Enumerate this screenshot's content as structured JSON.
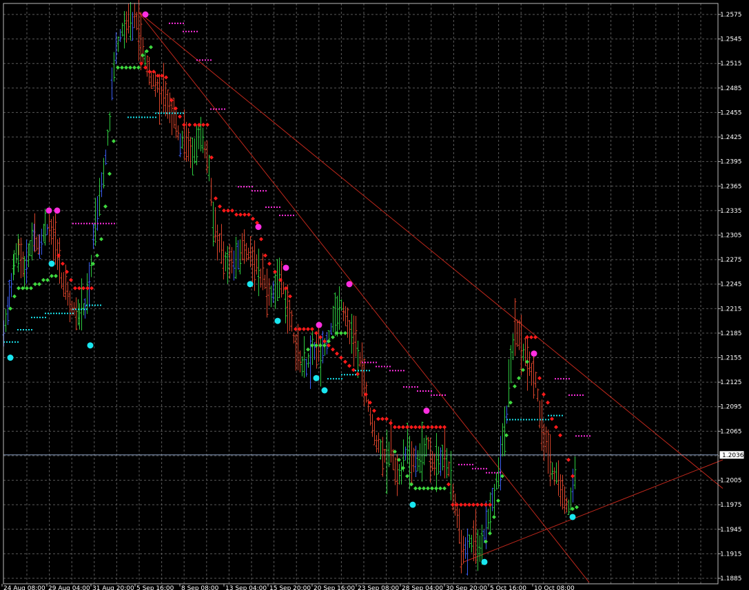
{
  "chart_data": {
    "type": "candlestick",
    "y_ticks": [
      "1.2575",
      "1.2545",
      "1.2515",
      "1.2485",
      "1.2455",
      "1.2425",
      "1.2395",
      "1.2365",
      "1.2335",
      "1.2305",
      "1.2275",
      "1.2245",
      "1.2215",
      "1.2185",
      "1.2155",
      "1.2125",
      "1.2095",
      "1.2065",
      "1.2035",
      "1.2005",
      "1.1975",
      "1.1945",
      "1.1915",
      "1.1885"
    ],
    "x_ticks": [
      "24 Aug 08:00",
      "29 Aug 04:00",
      "31 Aug 20:00",
      "5 Sep 16:00",
      "8 Sep 08:00",
      "13 Sep 04:00",
      "15 Sep 20:00",
      "20 Sep 16:00",
      "23 Sep 08:00",
      "28 Sep 04:00",
      "30 Sep 20:00",
      "5 Oct 16:00",
      "10 Oct 08:00"
    ],
    "ylim": [
      1.1885,
      1.26
    ],
    "current_price": "1.2036",
    "grid": true,
    "background": "#000000",
    "grid_color": "#5a5a5a",
    "colors": {
      "bull": "#2ecc40",
      "bear": "#d9442b",
      "blue": "#3a5cf0",
      "red_dots": "#ff1a1a",
      "green_dots": "#3fd83f",
      "cyan_dots": "#19e6f0",
      "magenta_dots": "#ff2ee0",
      "trendline": "#c0281c",
      "price_line": "#8fa6c8"
    },
    "price_path": [
      [
        0,
        1.218
      ],
      [
        8,
        1.223
      ],
      [
        15,
        1.227
      ],
      [
        22,
        1.229
      ],
      [
        30,
        1.226
      ],
      [
        38,
        1.229
      ],
      [
        45,
        1.23
      ],
      [
        52,
        1.2295
      ],
      [
        60,
        1.231
      ],
      [
        66,
        1.2315
      ],
      [
        72,
        1.23
      ],
      [
        78,
        1.229
      ],
      [
        84,
        1.225
      ],
      [
        90,
        1.224
      ],
      [
        96,
        1.222
      ],
      [
        102,
        1.2215
      ],
      [
        110,
        1.221
      ],
      [
        118,
        1.2215
      ],
      [
        124,
        1.224
      ],
      [
        130,
        1.23
      ],
      [
        136,
        1.233
      ],
      [
        142,
        1.237
      ],
      [
        148,
        1.24
      ],
      [
        154,
        1.245
      ],
      [
        160,
        1.251
      ],
      [
        166,
        1.254
      ],
      [
        172,
        1.2555
      ],
      [
        178,
        1.2565
      ],
      [
        184,
        1.256
      ],
      [
        190,
        1.257
      ],
      [
        196,
        1.256
      ],
      [
        202,
        1.253
      ],
      [
        208,
        1.251
      ],
      [
        214,
        1.25
      ],
      [
        220,
        1.249
      ],
      [
        226,
        1.248
      ],
      [
        232,
        1.2475
      ],
      [
        238,
        1.247
      ],
      [
        244,
        1.2455
      ],
      [
        250,
        1.244
      ],
      [
        256,
        1.242
      ],
      [
        262,
        1.242
      ],
      [
        268,
        1.241
      ],
      [
        274,
        1.24
      ],
      [
        280,
        1.242
      ],
      [
        286,
        1.243
      ],
      [
        292,
        1.241
      ],
      [
        298,
        1.239
      ],
      [
        304,
        1.233
      ],
      [
        310,
        1.23
      ],
      [
        316,
        1.2285
      ],
      [
        322,
        1.2275
      ],
      [
        328,
        1.228
      ],
      [
        334,
        1.227
      ],
      [
        340,
        1.228
      ],
      [
        346,
        1.229
      ],
      [
        352,
        1.2285
      ],
      [
        358,
        1.228
      ],
      [
        364,
        1.227
      ],
      [
        370,
        1.226
      ],
      [
        376,
        1.225
      ],
      [
        382,
        1.224
      ],
      [
        388,
        1.223
      ],
      [
        394,
        1.2235
      ],
      [
        400,
        1.225
      ],
      [
        406,
        1.224
      ],
      [
        412,
        1.222
      ],
      [
        418,
        1.22
      ],
      [
        424,
        1.216
      ],
      [
        430,
        1.215
      ],
      [
        436,
        1.2145
      ],
      [
        442,
        1.215
      ],
      [
        448,
        1.216
      ],
      [
        454,
        1.217
      ],
      [
        460,
        1.216
      ],
      [
        466,
        1.217
      ],
      [
        472,
        1.218
      ],
      [
        478,
        1.22
      ],
      [
        484,
        1.2215
      ],
      [
        490,
        1.222
      ],
      [
        496,
        1.221
      ],
      [
        502,
        1.219
      ],
      [
        508,
        1.218
      ],
      [
        514,
        1.216
      ],
      [
        520,
        1.214
      ],
      [
        526,
        1.211
      ],
      [
        532,
        1.208
      ],
      [
        538,
        1.206
      ],
      [
        544,
        1.205
      ],
      [
        550,
        1.204
      ],
      [
        556,
        1.203
      ],
      [
        562,
        1.204
      ],
      [
        568,
        1.202
      ],
      [
        574,
        1.201
      ],
      [
        580,
        1.203
      ],
      [
        586,
        1.204
      ],
      [
        592,
        1.203
      ],
      [
        598,
        1.2025
      ],
      [
        604,
        1.2035
      ],
      [
        610,
        1.204
      ],
      [
        616,
        1.205
      ],
      [
        622,
        1.203
      ],
      [
        628,
        1.202
      ],
      [
        634,
        1.203
      ],
      [
        640,
        1.204
      ],
      [
        646,
        1.202
      ],
      [
        652,
        1.199
      ],
      [
        658,
        1.196
      ],
      [
        664,
        1.193
      ],
      [
        670,
        1.192
      ],
      [
        676,
        1.193
      ],
      [
        682,
        1.1935
      ],
      [
        688,
        1.192
      ],
      [
        694,
        1.1925
      ],
      [
        700,
        1.195
      ],
      [
        706,
        1.197
      ],
      [
        712,
        1.199
      ],
      [
        718,
        1.201
      ],
      [
        724,
        1.205
      ],
      [
        730,
        1.209
      ],
      [
        736,
        1.215
      ],
      [
        742,
        1.219
      ],
      [
        748,
        1.218
      ],
      [
        754,
        1.216
      ],
      [
        760,
        1.215
      ],
      [
        766,
        1.214
      ],
      [
        772,
        1.213
      ],
      [
        778,
        1.209
      ],
      [
        784,
        1.206
      ],
      [
        790,
        1.204
      ],
      [
        796,
        1.202
      ],
      [
        802,
        1.201
      ],
      [
        808,
        1.2
      ],
      [
        814,
        1.198
      ],
      [
        820,
        1.1975
      ],
      [
        826,
        1.199
      ],
      [
        832,
        1.2036
      ]
    ],
    "red_dots": [
      [
        200,
        1.2515
      ],
      [
        206,
        1.251
      ],
      [
        212,
        1.2505
      ],
      [
        218,
        1.2505
      ],
      [
        224,
        1.25
      ],
      [
        230,
        1.25
      ],
      [
        236,
        1.2498
      ],
      [
        244,
        1.247
      ],
      [
        250,
        1.246
      ],
      [
        256,
        1.245
      ],
      [
        262,
        1.244
      ],
      [
        270,
        1.244
      ],
      [
        278,
        1.244
      ],
      [
        284,
        1.244
      ],
      [
        290,
        1.244
      ],
      [
        296,
        1.244
      ],
      [
        302,
        1.24
      ],
      [
        308,
        1.235
      ],
      [
        314,
        1.234
      ],
      [
        320,
        1.2335
      ],
      [
        326,
        1.2335
      ],
      [
        332,
        1.2335
      ],
      [
        338,
        1.233
      ],
      [
        344,
        1.233
      ],
      [
        350,
        1.233
      ],
      [
        356,
        1.233
      ],
      [
        362,
        1.2325
      ],
      [
        368,
        1.232
      ],
      [
        374,
        1.23
      ],
      [
        380,
        1.228
      ],
      [
        386,
        1.227
      ],
      [
        394,
        1.226
      ],
      [
        402,
        1.225
      ],
      [
        410,
        1.224
      ],
      [
        416,
        1.223
      ],
      [
        424,
        1.219
      ],
      [
        430,
        1.219
      ],
      [
        436,
        1.219
      ],
      [
        442,
        1.219
      ],
      [
        448,
        1.219
      ],
      [
        454,
        1.2185
      ],
      [
        460,
        1.218
      ],
      [
        466,
        1.2175
      ],
      [
        472,
        1.217
      ],
      [
        478,
        1.2165
      ],
      [
        484,
        1.216
      ],
      [
        490,
        1.2155
      ],
      [
        496,
        1.215
      ],
      [
        502,
        1.2145
      ],
      [
        508,
        1.214
      ],
      [
        514,
        1.2135
      ],
      [
        526,
        1.211
      ],
      [
        532,
        1.21
      ],
      [
        538,
        1.209
      ],
      [
        544,
        1.208
      ],
      [
        550,
        1.208
      ],
      [
        556,
        1.208
      ],
      [
        562,
        1.2075
      ],
      [
        568,
        1.207
      ],
      [
        574,
        1.207
      ],
      [
        580,
        1.207
      ],
      [
        586,
        1.207
      ],
      [
        592,
        1.207
      ],
      [
        598,
        1.207
      ],
      [
        604,
        1.207
      ],
      [
        610,
        1.207
      ],
      [
        616,
        1.207
      ],
      [
        622,
        1.207
      ],
      [
        628,
        1.207
      ],
      [
        634,
        1.207
      ],
      [
        640,
        1.207
      ],
      [
        646,
        1.2
      ],
      [
        652,
        1.1975
      ],
      [
        658,
        1.1975
      ],
      [
        664,
        1.1975
      ],
      [
        670,
        1.1975
      ],
      [
        676,
        1.1975
      ],
      [
        682,
        1.1975
      ],
      [
        688,
        1.1975
      ],
      [
        694,
        1.1975
      ],
      [
        700,
        1.1975
      ],
      [
        706,
        1.1975
      ],
      [
        760,
        1.218
      ],
      [
        766,
        1.218
      ],
      [
        772,
        1.218
      ],
      [
        778,
        1.213
      ],
      [
        784,
        1.211
      ],
      [
        790,
        1.21
      ],
      [
        796,
        1.208
      ],
      [
        802,
        1.207
      ],
      [
        808,
        1.206
      ],
      [
        820,
        1.203
      ],
      [
        826,
        1.201
      ],
      [
        80,
        1.228
      ],
      [
        86,
        1.227
      ],
      [
        92,
        1.226
      ],
      [
        98,
        1.225
      ],
      [
        104,
        1.224
      ],
      [
        110,
        1.224
      ],
      [
        116,
        1.224
      ],
      [
        122,
        1.224
      ],
      [
        128,
        1.224
      ]
    ],
    "green_dots": [
      [
        10,
        1.2215
      ],
      [
        16,
        1.223
      ],
      [
        22,
        1.224
      ],
      [
        28,
        1.224
      ],
      [
        34,
        1.224
      ],
      [
        40,
        1.224
      ],
      [
        46,
        1.2245
      ],
      [
        52,
        1.2245
      ],
      [
        58,
        1.225
      ],
      [
        64,
        1.225
      ],
      [
        70,
        1.2255
      ],
      [
        76,
        1.2255
      ],
      [
        130,
        1.227
      ],
      [
        136,
        1.228
      ],
      [
        142,
        1.23
      ],
      [
        148,
        1.234
      ],
      [
        154,
        1.238
      ],
      [
        160,
        1.242
      ],
      [
        166,
        1.251
      ],
      [
        172,
        1.251
      ],
      [
        178,
        1.251
      ],
      [
        184,
        1.251
      ],
      [
        190,
        1.251
      ],
      [
        196,
        1.251
      ],
      [
        202,
        1.2525
      ],
      [
        208,
        1.253
      ],
      [
        214,
        1.2535
      ],
      [
        442,
        1.2165
      ],
      [
        448,
        1.217
      ],
      [
        454,
        1.217
      ],
      [
        460,
        1.217
      ],
      [
        466,
        1.217
      ],
      [
        472,
        1.2175
      ],
      [
        478,
        1.218
      ],
      [
        484,
        1.2185
      ],
      [
        490,
        1.2185
      ],
      [
        496,
        1.2185
      ],
      [
        568,
        1.204
      ],
      [
        574,
        1.203
      ],
      [
        580,
        1.202
      ],
      [
        586,
        1.201
      ],
      [
        592,
        1.2
      ],
      [
        598,
        1.1995
      ],
      [
        604,
        1.1995
      ],
      [
        610,
        1.1995
      ],
      [
        616,
        1.1995
      ],
      [
        622,
        1.1995
      ],
      [
        628,
        1.1995
      ],
      [
        634,
        1.1995
      ],
      [
        640,
        1.1995
      ],
      [
        700,
        1.193
      ],
      [
        706,
        1.194
      ],
      [
        712,
        1.196
      ],
      [
        718,
        1.198
      ],
      [
        724,
        1.201
      ],
      [
        730,
        1.206
      ],
      [
        736,
        1.21
      ],
      [
        742,
        1.212
      ],
      [
        748,
        1.213
      ],
      [
        754,
        1.214
      ],
      [
        760,
        1.215
      ],
      [
        826,
        1.197
      ],
      [
        832,
        1.1972
      ]
    ],
    "cyan_dots_small": [
      [
        0,
        1.2175
      ],
      [
        20,
        1.219
      ],
      [
        40,
        1.2205
      ],
      [
        60,
        1.221
      ],
      [
        80,
        1.221
      ],
      [
        100,
        1.2215
      ],
      [
        120,
        1.222
      ],
      [
        180,
        1.245
      ],
      [
        200,
        1.245
      ],
      [
        220,
        1.2455
      ],
      [
        240,
        1.2455
      ],
      [
        470,
        1.213
      ],
      [
        490,
        1.2135
      ],
      [
        510,
        1.214
      ],
      [
        730,
        1.208
      ],
      [
        750,
        1.208
      ],
      [
        770,
        1.208
      ],
      [
        790,
        1.2085
      ]
    ],
    "magenta_dots_small": [
      [
        100,
        1.232
      ],
      [
        120,
        1.232
      ],
      [
        140,
        1.232
      ],
      [
        240,
        1.2565
      ],
      [
        260,
        1.2555
      ],
      [
        280,
        1.252
      ],
      [
        300,
        1.246
      ],
      [
        340,
        1.2365
      ],
      [
        360,
        1.236
      ],
      [
        380,
        1.234
      ],
      [
        400,
        1.233
      ],
      [
        520,
        1.215
      ],
      [
        540,
        1.2145
      ],
      [
        560,
        1.214
      ],
      [
        580,
        1.212
      ],
      [
        600,
        1.2115
      ],
      [
        620,
        1.211
      ],
      [
        660,
        1.2025
      ],
      [
        680,
        1.202
      ],
      [
        700,
        1.2015
      ],
      [
        800,
        1.213
      ],
      [
        820,
        1.211
      ],
      [
        830,
        1.206
      ]
    ],
    "cyan_circles": [
      [
        10,
        1.2155
      ],
      [
        70,
        1.227
      ],
      [
        126,
        1.217
      ],
      [
        358,
        1.2245
      ],
      [
        398,
        1.22
      ],
      [
        454,
        1.213
      ],
      [
        466,
        1.2115
      ],
      [
        594,
        1.1975
      ],
      [
        698,
        1.1905
      ],
      [
        826,
        1.196
      ]
    ],
    "magenta_circles": [
      [
        66,
        1.2335
      ],
      [
        78,
        1.2335
      ],
      [
        206,
        1.2575
      ],
      [
        370,
        1.2315
      ],
      [
        410,
        1.2265
      ],
      [
        458,
        1.2195
      ],
      [
        502,
        1.2245
      ],
      [
        614,
        1.209
      ],
      [
        770,
        1.216
      ]
    ],
    "trendlines": [
      [
        196,
        1.2578,
        1044,
        1.1995
      ],
      [
        196,
        1.2578,
        850,
        1.188
      ],
      [
        668,
        1.1905,
        1044,
        1.203
      ]
    ]
  }
}
